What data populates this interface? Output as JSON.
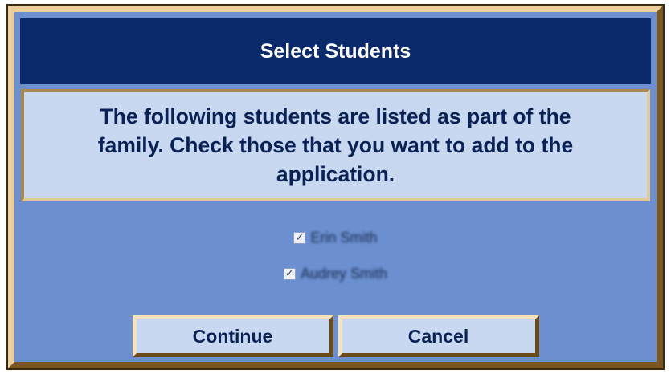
{
  "dialog": {
    "title": "Select Students",
    "message": "The following students are listed as part of the family. Check those that you want to add to the application."
  },
  "students": [
    {
      "name": "Erin Smith",
      "checked": true
    },
    {
      "name": "Audrey Smith",
      "checked": true
    }
  ],
  "buttons": {
    "continue_label": "Continue",
    "cancel_label": "Cancel"
  },
  "colors": {
    "title_bar": "#0b2a6b",
    "dialog_body": "#6b8fcf",
    "message_panel": "#c9d8f1",
    "frame_light": "#e8cf9d",
    "frame_dark": "#7a5623"
  }
}
